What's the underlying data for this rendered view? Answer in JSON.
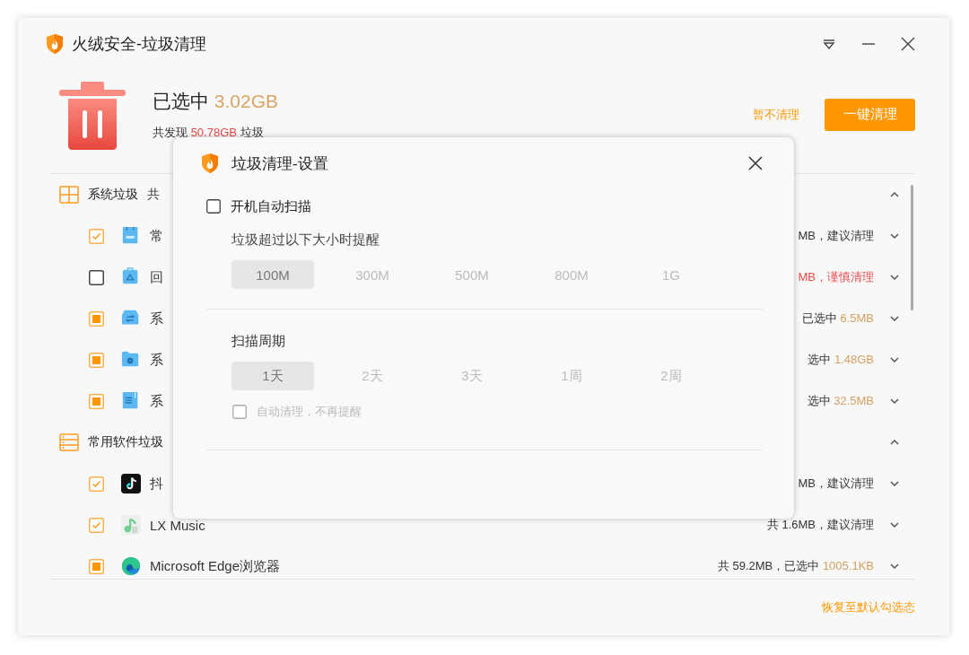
{
  "window": {
    "title": "火绒安全-垃圾清理"
  },
  "summary": {
    "selected_label": "已选中",
    "selected_size": "3.02GB",
    "found_prefix": "共发现",
    "found_size": "50.78GB",
    "found_suffix": "垃圾"
  },
  "actions": {
    "skip": "暂不清理",
    "clean": "一键清理"
  },
  "sections": [
    {
      "kind": "windows",
      "name": "系统垃圾",
      "info": "共",
      "expanded": true,
      "rows": [
        {
          "kind": "log-folder",
          "checked": true,
          "partial": false,
          "name": "常",
          "info": "MB，建议清理",
          "warn": false,
          "expanded": false
        },
        {
          "kind": "recycle-folder",
          "checked": false,
          "partial": false,
          "name": "回",
          "info": "MB，谨慎清理",
          "warn": true,
          "expanded": false
        },
        {
          "kind": "sync-folder",
          "checked": false,
          "partial": true,
          "name": "系",
          "info": "已选中",
          "size": "6.5MB",
          "warn": false,
          "expanded": false
        },
        {
          "kind": "disk-folder",
          "checked": false,
          "partial": true,
          "name": "系",
          "info": "选中",
          "size": "1.48GB",
          "warn": false,
          "expanded": false
        },
        {
          "kind": "doc-folder",
          "checked": false,
          "partial": true,
          "name": "系",
          "info": "选中",
          "size": "32.5MB",
          "warn": false,
          "expanded": false
        }
      ]
    },
    {
      "kind": "list",
      "name": "常用软件垃圾",
      "expanded": true,
      "rows": [
        {
          "kind": "video-app",
          "checked": true,
          "partial": false,
          "name": "抖",
          "info": "MB，建议清理",
          "warn": false,
          "expanded": false
        },
        {
          "kind": "music-app",
          "checked": true,
          "partial": false,
          "name": "LX Music",
          "info": "共 1.6MB，建议清理",
          "warn": false,
          "expanded": false
        },
        {
          "kind": "browser-app",
          "checked": false,
          "partial": true,
          "name": "Microsoft Edge浏览器",
          "info": "共 59.2MB，已选中",
          "size": "1005.1KB",
          "warn": false,
          "expanded": false
        }
      ]
    }
  ],
  "footer": {
    "link": "恢复至默认勾选态"
  },
  "dialog": {
    "title": "垃圾清理-设置",
    "autoscan": {
      "label": "开机自动扫描",
      "checked": false
    },
    "size_label": "垃圾超过以下大小时提醒",
    "size_options": [
      {
        "label": "100M",
        "selected": true
      },
      {
        "label": "300M",
        "selected": false
      },
      {
        "label": "500M",
        "selected": false
      },
      {
        "label": "800M",
        "selected": false
      },
      {
        "label": "1G",
        "selected": false
      }
    ],
    "period_label": "扫描周期",
    "period_options": [
      {
        "label": "1天",
        "selected": true
      },
      {
        "label": "2天",
        "selected": false
      },
      {
        "label": "3天",
        "selected": false
      },
      {
        "label": "1周",
        "selected": false
      },
      {
        "label": "2周",
        "selected": false
      }
    ],
    "autoclean": {
      "label": "自动清理，不再提醒",
      "checked": false,
      "disabled": true
    }
  }
}
